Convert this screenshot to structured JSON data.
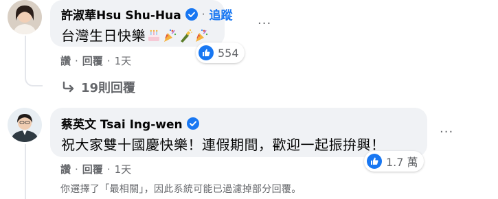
{
  "comments": [
    {
      "author": "許淑華Hsu Shu-Hua",
      "follow_label": "追蹤",
      "follow_dot": "·",
      "text": "台灣生日快樂",
      "reaction_count": "554",
      "actions": {
        "like": "讚",
        "reply": "回覆",
        "time": "1天",
        "sep": "·"
      },
      "replies_label": "19則回覆"
    },
    {
      "author": "蔡英文 Tsai Ing-wen",
      "text": "祝大家雙十國慶快樂！連假期間，歡迎一起振拚興！",
      "reaction_count": "1.7 萬",
      "actions": {
        "like": "讚",
        "reply": "回覆",
        "time": "1天",
        "sep": "·"
      }
    }
  ],
  "filter_notice": "你選擇了「最相關」，因此系統可能已過濾掉部分回覆。",
  "more_label": "···",
  "icons": {
    "verified": "verified-badge-icon",
    "like": "thumbs-up-icon",
    "reply_arrow": "reply-arrow-icon",
    "emoji": [
      "cake-emoji",
      "party-popper-emoji",
      "champagne-emoji",
      "party-popper-emoji"
    ]
  },
  "colors": {
    "accent": "#1877f2",
    "bubble": "#f0f2f5",
    "muted": "#65676b"
  }
}
